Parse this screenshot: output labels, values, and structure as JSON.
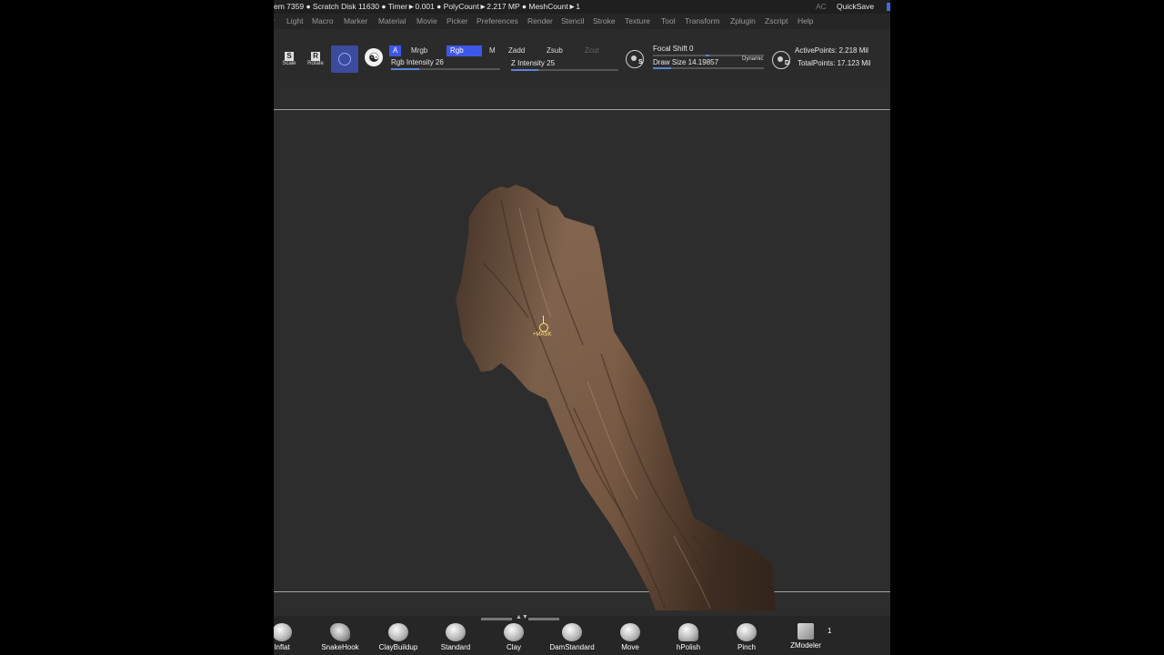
{
  "status": {
    "info": "em 7359 ● Scratch Disk 11630 ● Timer►0.001 ● PolyCount►2.217 MP ● MeshCount►1",
    "ac": "AC",
    "quicksave": "QuickSave"
  },
  "menu": [
    "Light",
    "Macro",
    "Marker",
    "Material",
    "Movie",
    "Picker",
    "Preferences",
    "Render",
    "Stencil",
    "Stroke",
    "Texture",
    "Tool",
    "Transform",
    "Zplugin",
    "Zscript",
    "Help"
  ],
  "toolbar": {
    "scale": "Scale",
    "rotate": "Rotate",
    "a": "A",
    "mrgb": "Mrgb",
    "rgb": "Rgb",
    "m": "M",
    "zadd": "Zadd",
    "zsub": "Zsub",
    "zcut": "Zcut",
    "rgb_intensity": "Rgb Intensity 26",
    "z_intensity": "Z Intensity 25",
    "focal_shift": "Focal Shift 0",
    "draw_size": "Draw Size 14.19857",
    "dynamic": "Dynamic",
    "active_points": "ActivePoints: 2.218 Mil",
    "total_points": "TotalPoints: 17.123 Mil",
    "s_letter": "S",
    "d_letter": "D",
    "rgb_intensity_value": 26,
    "z_intensity_value": 25
  },
  "canvas": {
    "cursor_label": "+MASK"
  },
  "shelf": {
    "brushes": [
      "Inflat",
      "SnakeHook",
      "ClayBuildup",
      "Standard",
      "Clay",
      "DamStandard",
      "Move",
      "hPolish",
      "Pinch",
      "ZModeler"
    ],
    "count": "1"
  },
  "colors": {
    "accent": "#3f57e6",
    "skin": "#8a6a52"
  }
}
